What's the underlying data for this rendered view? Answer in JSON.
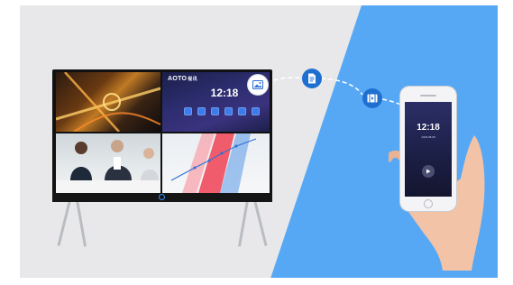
{
  "tv": {
    "brand": "AOTO",
    "brand_suffix": "视讯",
    "clock": "12:18",
    "quadrants": [
      "city-aerial-night",
      "home-screen",
      "business-meeting",
      "data-chart"
    ],
    "app_icon_count": 6
  },
  "phone": {
    "clock": "12:18",
    "subtitle": "2018-08-08"
  },
  "transfer_icons": [
    "image-icon",
    "document-icon",
    "video-icon"
  ],
  "colors": {
    "background_gray": "#e8e8ea",
    "background_blue": "#57a8f4",
    "icon_blue": "#1e6fd0"
  }
}
